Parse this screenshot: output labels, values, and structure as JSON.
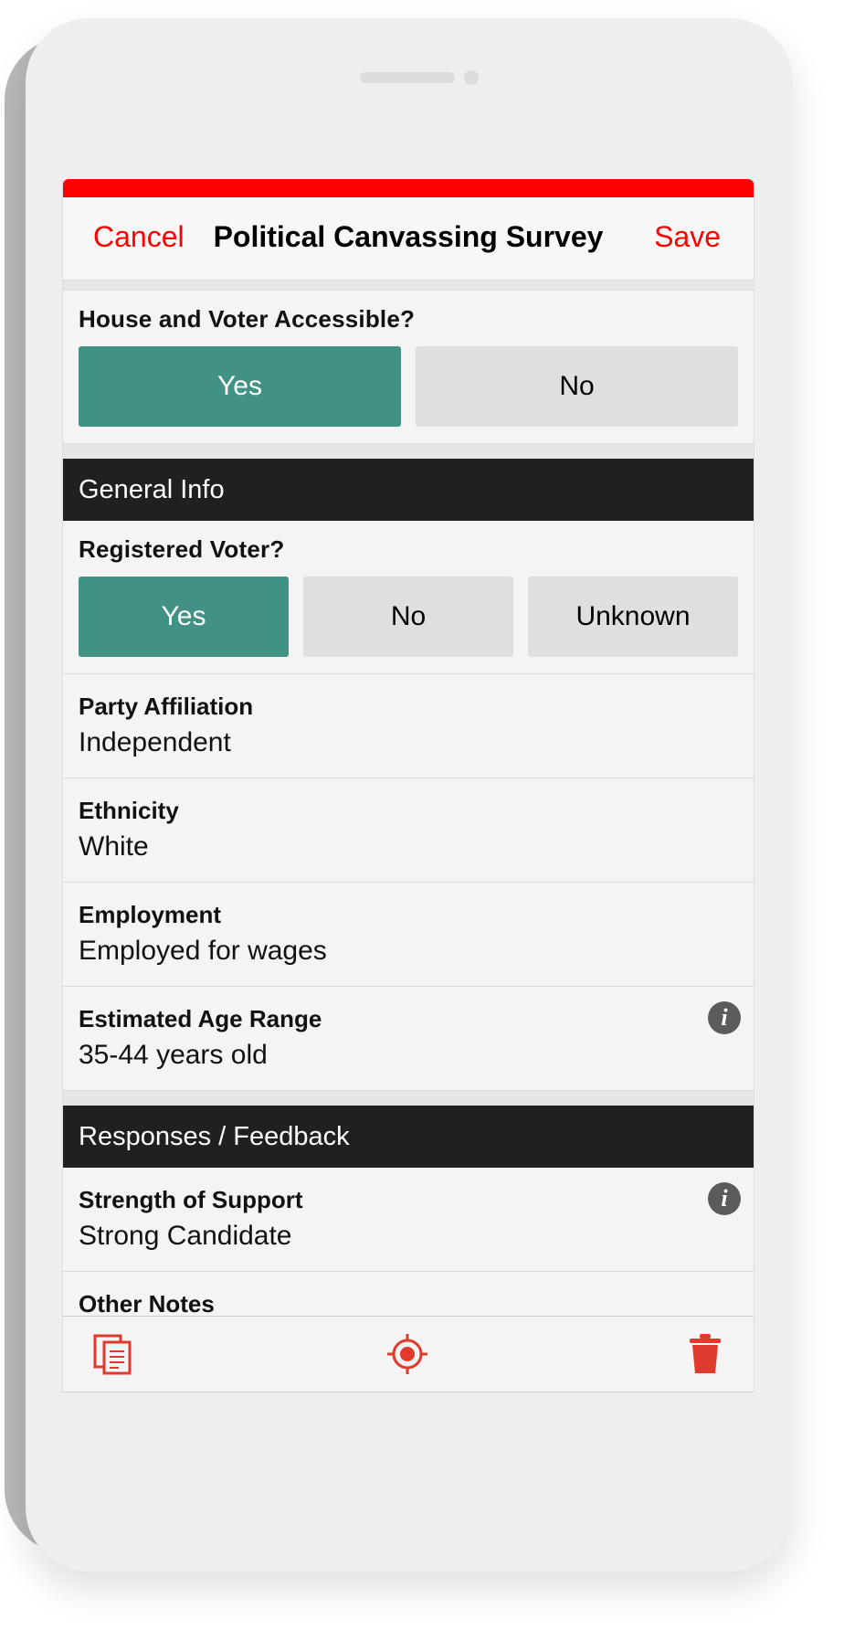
{
  "navbar": {
    "cancel_label": "Cancel",
    "title": "Political Canvassing Survey",
    "save_label": "Save"
  },
  "accessible": {
    "question": "House and Voter Accessible?",
    "options": [
      "Yes",
      "No"
    ],
    "selected": "Yes"
  },
  "general_info": {
    "header": "General Info",
    "registered": {
      "question": "Registered Voter?",
      "options": [
        "Yes",
        "No",
        "Unknown"
      ],
      "selected": "Yes"
    },
    "fields": [
      {
        "label": "Party Affiliation",
        "value": "Independent"
      },
      {
        "label": "Ethnicity",
        "value": "White"
      },
      {
        "label": "Employment",
        "value": "Employed for wages"
      },
      {
        "label": "Estimated Age Range",
        "value": "35-44 years old"
      }
    ]
  },
  "responses": {
    "header": "Responses / Feedback",
    "fields": [
      {
        "label": "Strength of Support",
        "value": "Strong Candidate"
      },
      {
        "label": "Other Notes",
        "value": ""
      }
    ]
  },
  "info_icon_glyph": "i",
  "toolbar": {
    "icons": [
      "copy-icon",
      "locate-icon",
      "trash-icon"
    ]
  },
  "colors": {
    "accent": "#ff0000",
    "selected": "#419184",
    "section_header": "#202020"
  }
}
